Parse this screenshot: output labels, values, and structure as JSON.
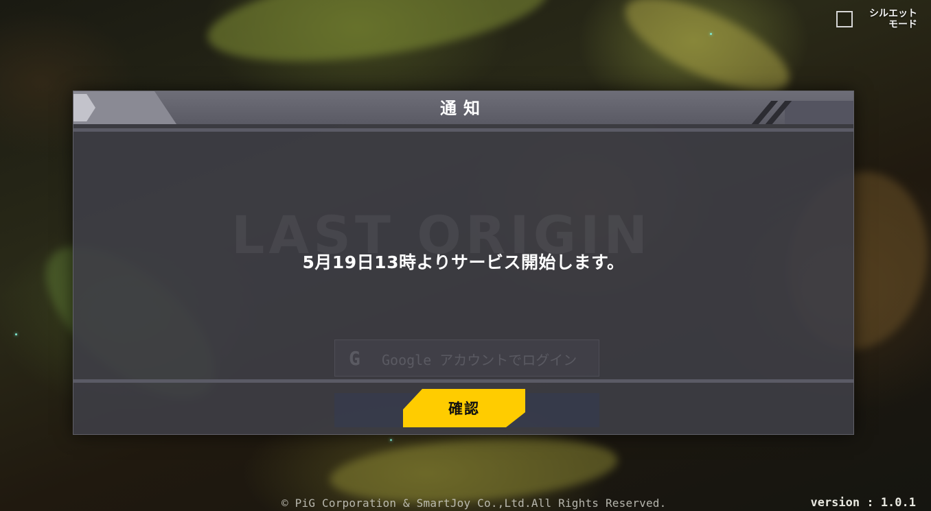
{
  "background": {
    "title_watermark": "LAST ORIGIN",
    "login_google_label": "Google アカウントでログイン"
  },
  "silhouette_toggle": {
    "label": "シルエット\nモード",
    "checked": false
  },
  "dialog": {
    "title": "通知",
    "message": "5月19日13時よりサービス開始します。",
    "confirm_label": "確認"
  },
  "footer": {
    "copyright": "© PiG Corporation & SmartJoy Co.,Ltd.All Rights Reserved.",
    "version": "version : 1.0.1"
  },
  "colors": {
    "accent": "#ffcc00",
    "dialog_bg": "#3e3e46",
    "header_bg": "#66666f",
    "text": "#ffffff"
  }
}
